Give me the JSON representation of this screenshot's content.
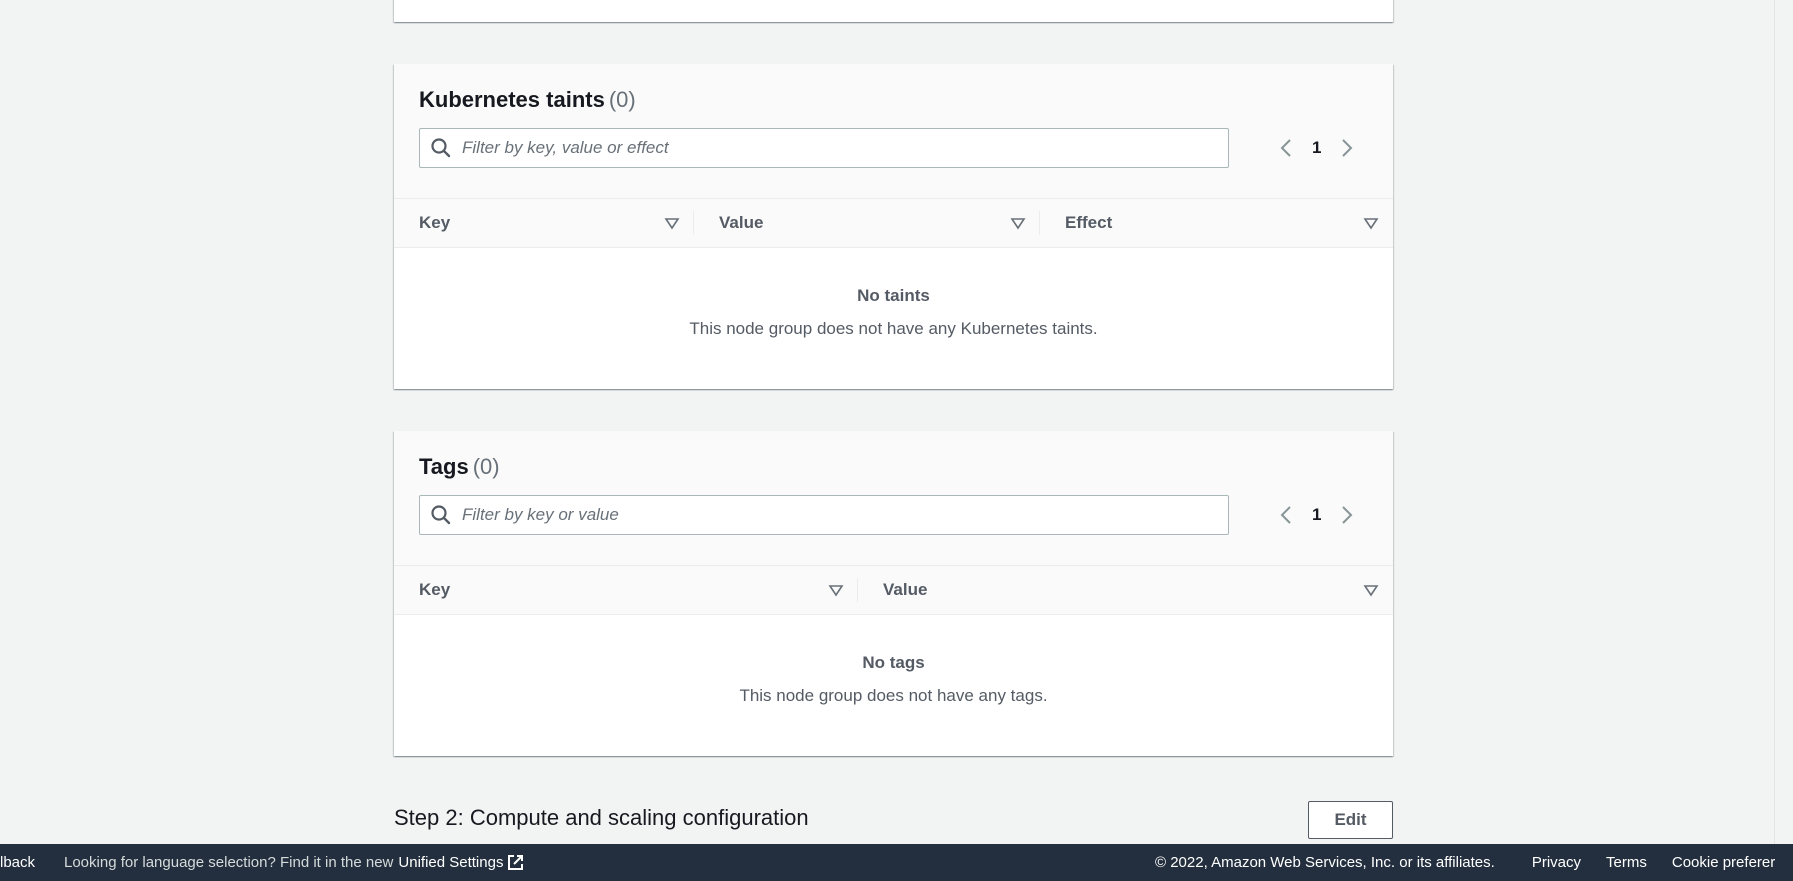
{
  "taints": {
    "title": "Kubernetes taints",
    "count": "(0)",
    "filter_placeholder": "Filter by key, value or effect",
    "page": "1",
    "columns": [
      "Key",
      "Value",
      "Effect"
    ],
    "empty_title": "No taints",
    "empty_desc": "This node group does not have any Kubernetes taints."
  },
  "tags": {
    "title": "Tags",
    "count": "(0)",
    "filter_placeholder": "Filter by key or value",
    "page": "1",
    "columns": [
      "Key",
      "Value"
    ],
    "empty_title": "No tags",
    "empty_desc": "This node group does not have any tags."
  },
  "step2": {
    "title": "Step 2: Compute and scaling configuration",
    "edit_label": "Edit"
  },
  "footer": {
    "feedback": "lback",
    "lang_msg": "Looking for language selection? Find it in the new",
    "unified_settings": "Unified Settings",
    "copyright": "© 2022, Amazon Web Services, Inc. or its affiliates.",
    "privacy": "Privacy",
    "terms": "Terms",
    "cookie": "Cookie preferer"
  },
  "icons": {
    "search": "search-icon",
    "sort": "sort-caret-icon",
    "prev": "chevron-left-icon",
    "next": "chevron-right-icon",
    "external": "external-link-icon"
  }
}
